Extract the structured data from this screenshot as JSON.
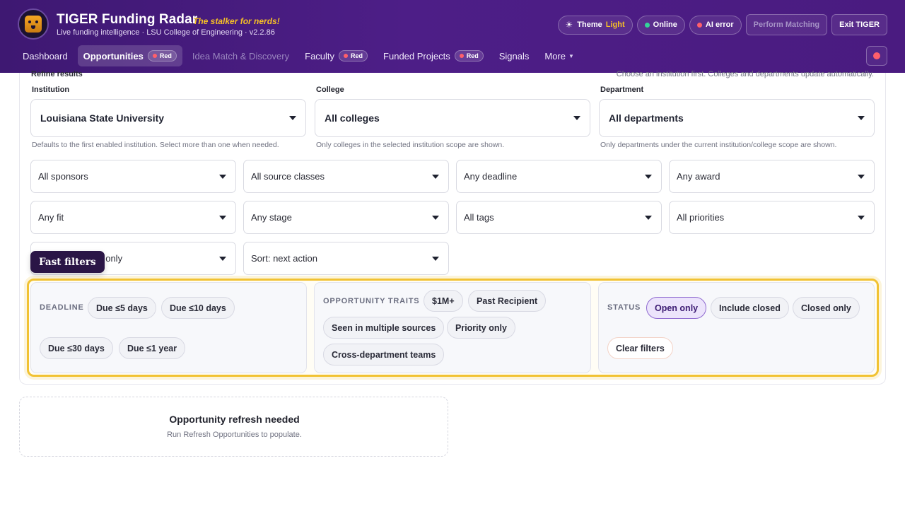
{
  "app": {
    "title": "TIGER Funding Radar",
    "tagline": "The stalker for nerds!",
    "subtitle": "Live funding intelligence · LSU College of Engineering · v2.2.86",
    "logo_icon": "tiger-logo-icon"
  },
  "top_bar": {
    "theme_label": "Theme",
    "theme_value": "Light",
    "online_label": "Online",
    "ai_error_label": "AI error",
    "perform_matching_label": "Perform Matching",
    "exit_label": "Exit TIGER",
    "colors": {
      "online_dot": "#34d399",
      "error_dot": "#ff5f6b",
      "accent_yellow": "#f6c026"
    }
  },
  "nav": {
    "items": [
      {
        "label": "Dashboard",
        "badge": ""
      },
      {
        "label": "Opportunities",
        "badge": "Red",
        "active": true
      },
      {
        "label": "Idea Match & Discovery",
        "badge": "",
        "muted": true
      },
      {
        "label": "Faculty",
        "badge": "Red"
      },
      {
        "label": "Funded Projects",
        "badge": "Red"
      },
      {
        "label": "Signals",
        "badge": ""
      },
      {
        "label": "More",
        "badge": "",
        "dropdown": true
      }
    ]
  },
  "refine": {
    "label": "Refine results",
    "hint": "Choose an institution first. Colleges and departments update automatically."
  },
  "scope": {
    "institution": {
      "label": "Institution",
      "value": "Louisiana State University",
      "help": "Defaults to the first enabled institution. Select more than one when needed."
    },
    "college": {
      "label": "College",
      "value": "All colleges",
      "help": "Only colleges in the selected institution scope are shown."
    },
    "department": {
      "label": "Department",
      "value": "All departments",
      "help": "Only departments under the current institution/college scope are shown."
    }
  },
  "filters": {
    "sponsor": "All sponsors",
    "source_class": "All source classes",
    "deadline": "Any deadline",
    "award": "Any award",
    "fit": "Any fit",
    "stage": "Any stage",
    "tags": "All tags",
    "priorities": "All priorities",
    "open_only_partial": "t only",
    "sort": "Sort: next action"
  },
  "fast_filters": {
    "tag": "Fast filters",
    "deadline": {
      "title": "DEADLINE",
      "chips": [
        "Due ≤5 days",
        "Due ≤10 days",
        "Due ≤30 days",
        "Due ≤1 year"
      ]
    },
    "traits": {
      "title": "OPPORTUNITY TRAITS",
      "chips": [
        "$1M+",
        "Past Recipient",
        "Seen in multiple sources",
        "Priority only",
        "Cross-department teams"
      ]
    },
    "status": {
      "title": "STATUS",
      "chips": [
        "Open only",
        "Include closed",
        "Closed only"
      ],
      "selected": "Open only",
      "clear_label": "Clear filters"
    },
    "highlight_color": "#f1c232"
  },
  "empty_state": {
    "title": "Opportunity refresh needed",
    "subtitle": "Run Refresh Opportunities to populate."
  }
}
